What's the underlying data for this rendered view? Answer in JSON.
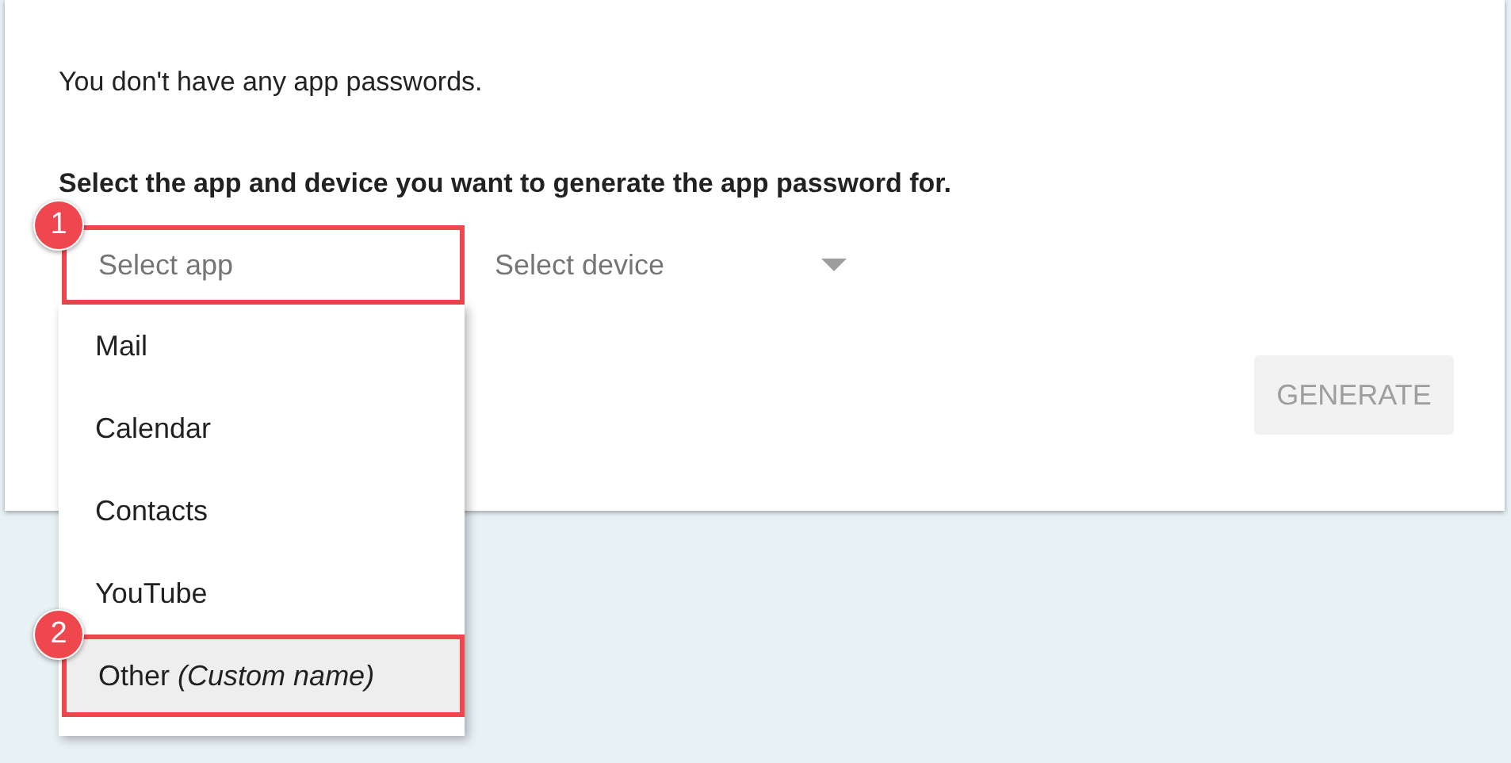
{
  "intro": "You don't have any app passwords.",
  "instruction": "Select the app and device you want to generate the app password for.",
  "app_select": {
    "placeholder": "Select app",
    "callout": "1",
    "expanded": true,
    "options": [
      {
        "label": "Mail",
        "selected": false
      },
      {
        "label": "Calendar",
        "selected": false
      },
      {
        "label": "Contacts",
        "selected": false
      },
      {
        "label": "YouTube",
        "selected": false
      },
      {
        "label": "Other *(Custom name)*",
        "selected": true,
        "callout": "2"
      }
    ]
  },
  "device_select": {
    "placeholder": "Select device"
  },
  "generate_button": {
    "label": "GENERATE",
    "disabled": true
  }
}
